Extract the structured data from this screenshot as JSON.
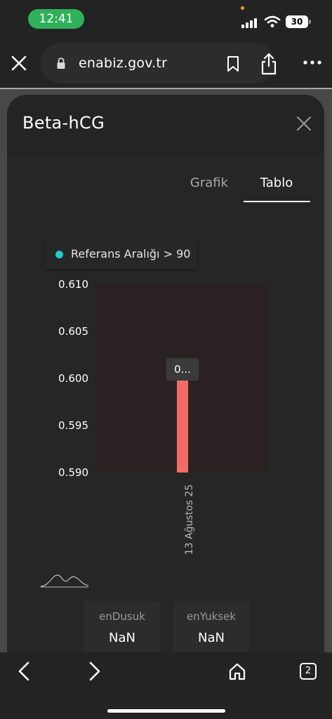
{
  "status_bar": {
    "time": "12:41",
    "battery": "30"
  },
  "browser": {
    "url": "enabiz.gov.tr"
  },
  "modal": {
    "title": "Beta-hCG"
  },
  "tabs": [
    {
      "label": "Grafik",
      "active": false
    },
    {
      "label": "Tablo",
      "active": true
    }
  ],
  "legend": {
    "label": "Referans Aralığı > 90"
  },
  "chart_data": {
    "type": "bar",
    "title": "",
    "xlabel": "",
    "ylabel": "",
    "categories": [
      "13 Ağustos 25"
    ],
    "values": [
      0.6
    ],
    "ylim": [
      0.59,
      0.61
    ],
    "yticks": [
      "0.610",
      "0.605",
      "0.600",
      "0.595",
      "0.590"
    ],
    "bar_label": "0...",
    "bar_color": "#f26c67"
  },
  "stats": [
    {
      "label": "enDusuk",
      "value": "NaN"
    },
    {
      "label": "enYuksek",
      "value": "NaN"
    }
  ],
  "bottom_nav": {
    "tabs_count": "2"
  }
}
